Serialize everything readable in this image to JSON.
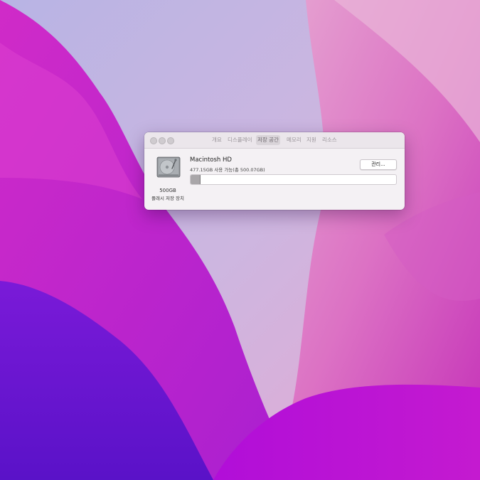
{
  "window": {
    "tabs": [
      {
        "label": "개요",
        "active": false
      },
      {
        "label": "디스플레이",
        "active": false
      },
      {
        "label": "저장 공간",
        "active": true
      },
      {
        "label": "메모리",
        "active": false
      },
      {
        "label": "지원",
        "active": false
      },
      {
        "label": "리소스",
        "active": false
      }
    ]
  },
  "storage": {
    "disk_size": "500GB",
    "disk_kind": "플래시 저장 장치",
    "volume_name": "Macintosh HD",
    "available_text": "477.15GB 사용 가능(총 500.07GB)",
    "manage_label": "관리...",
    "used_fraction": 0.046
  },
  "icons": {
    "disk": "hard-drive-icon",
    "close": "close-traffic-light",
    "minimize": "minimize-traffic-light",
    "zoom": "zoom-traffic-light"
  },
  "colors": {
    "wallpaper_magenta": "#c33fd0",
    "wallpaper_violet": "#6a1ad6",
    "wallpaper_pink": "#e2a4d4",
    "usage_bar": "#a9a6a9"
  }
}
